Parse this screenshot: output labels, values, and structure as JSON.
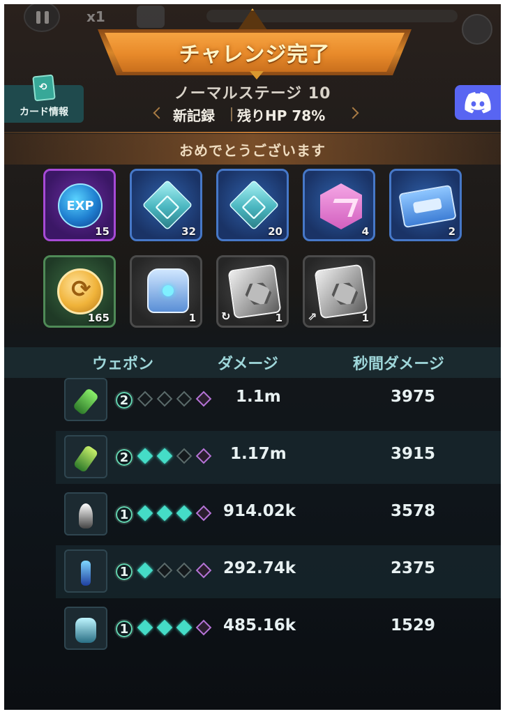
{
  "hud": {
    "speed_label": "x1"
  },
  "banner": {
    "title": "チャレンジ完了"
  },
  "card_info": {
    "label": "カード情報"
  },
  "stage": {
    "name": "ノーマルステージ 10",
    "new_record": "新記録",
    "remaining_hp": "残りHP 78%"
  },
  "congrats": "おめでとうございます",
  "rewards": [
    {
      "icon": "exp-orb-icon",
      "text": "EXP",
      "count": "15",
      "rarity": "purple"
    },
    {
      "icon": "weapon-chip-icon",
      "count": "32",
      "rarity": "blue"
    },
    {
      "icon": "turret-chip-icon",
      "count": "20",
      "rarity": "blue"
    },
    {
      "icon": "pink-hexagon-icon",
      "count": "4",
      "rarity": "blue"
    },
    {
      "icon": "blueprint-scroll-icon",
      "count": "2",
      "rarity": "blue"
    },
    {
      "icon": "gold-coin-icon",
      "count": "165",
      "rarity": "green"
    },
    {
      "icon": "armor-icon",
      "count": "1",
      "rarity": "gray"
    },
    {
      "icon": "plate-icon",
      "count": "1",
      "rarity": "gray"
    },
    {
      "icon": "plate-icon",
      "count": "1",
      "rarity": "gray"
    }
  ],
  "table": {
    "headers": {
      "weapon": "ウェポン",
      "damage": "ダメージ",
      "dps": "秒間ダメージ"
    },
    "rows": [
      {
        "weapon_icon": "green-cannon-icon",
        "level": "2",
        "stars_on": 0,
        "damage": "1.1m",
        "dps": "3975"
      },
      {
        "weapon_icon": "green-launcher-icon",
        "level": "2",
        "stars_on": 2,
        "damage": "1.17m",
        "dps": "3915"
      },
      {
        "weapon_icon": "robot-drone-icon",
        "level": "1",
        "stars_on": 3,
        "damage": "914.02k",
        "dps": "3578"
      },
      {
        "weapon_icon": "blue-flame-tower-icon",
        "level": "1",
        "stars_on": 1,
        "damage": "292.74k",
        "dps": "2375"
      },
      {
        "weapon_icon": "mech-robot-icon",
        "level": "1",
        "stars_on": 3,
        "damage": "485.16k",
        "dps": "1529"
      }
    ]
  },
  "colors": {
    "banner": "#e88a2a",
    "discord": "#5865f2",
    "star_on": "#45dcc7",
    "star_special": "#b473d6",
    "header_text": "#9fd7da"
  }
}
